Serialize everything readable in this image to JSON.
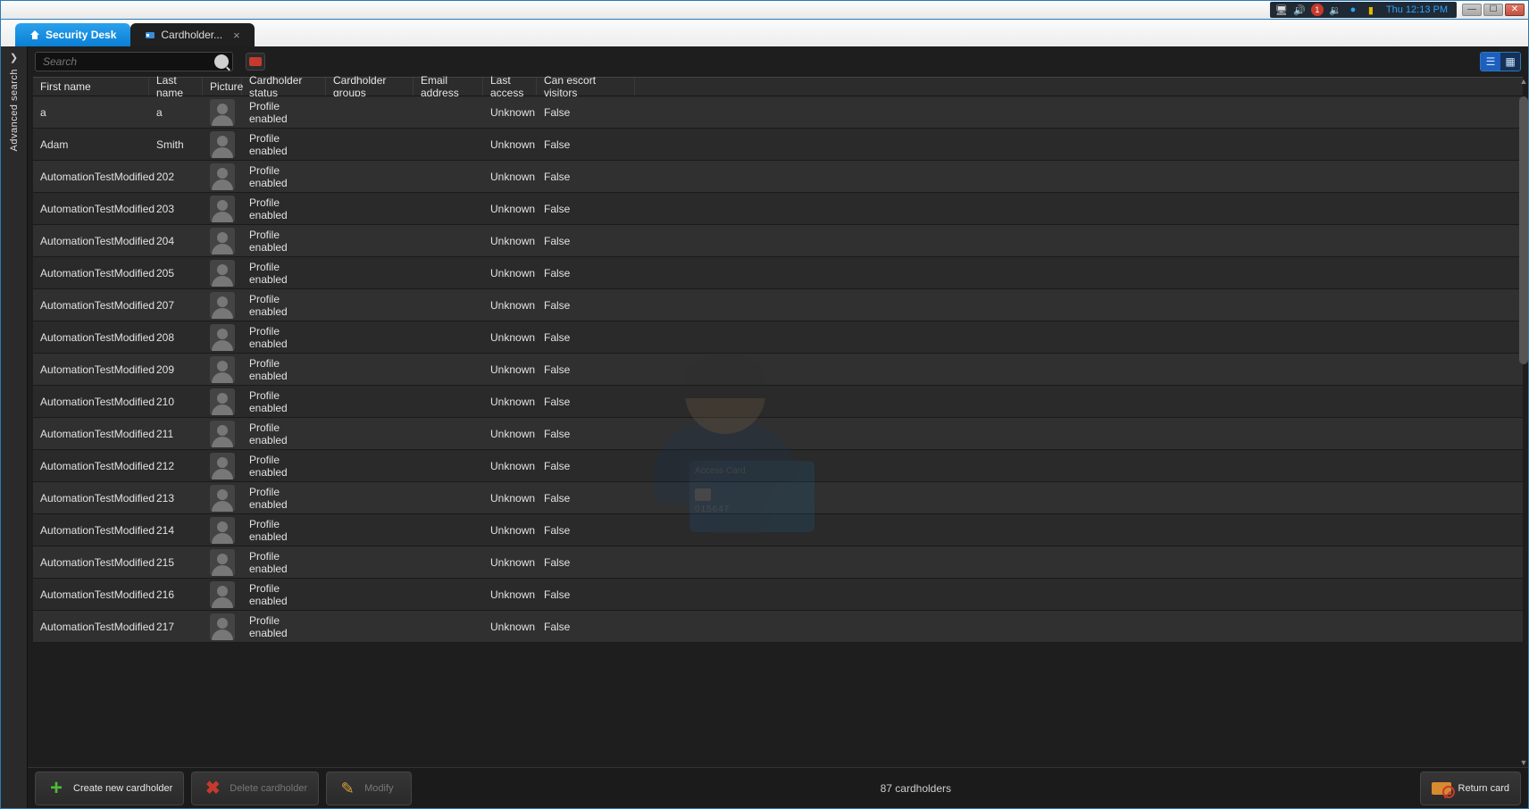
{
  "titlebar": {
    "clock": "Thu 12:13 PM",
    "tray_alert_badge": "1"
  },
  "tabs": {
    "home_label": "Security Desk",
    "active_label": "Cardholder..."
  },
  "sidebar": {
    "label": "Advanced search"
  },
  "toolbar": {
    "search_placeholder": "Search"
  },
  "columns": {
    "first_name": "First name",
    "last_name": "Last name",
    "picture": "Picture",
    "status": "Cardholder status",
    "groups": "Cardholder groups",
    "email": "Email address",
    "last_access": "Last access",
    "escort": "Can escort visitors"
  },
  "rows": [
    {
      "first": "a",
      "last": "a",
      "status": "Profile enabled",
      "groups": "",
      "email": "",
      "last_access": "Unknown",
      "escort": "False"
    },
    {
      "first": "Adam",
      "last": "Smith",
      "status": "Profile enabled",
      "groups": "",
      "email": "",
      "last_access": "Unknown",
      "escort": "False"
    },
    {
      "first": "AutomationTestModified",
      "last": "202",
      "status": "Profile enabled",
      "groups": "",
      "email": "",
      "last_access": "Unknown",
      "escort": "False"
    },
    {
      "first": "AutomationTestModified",
      "last": "203",
      "status": "Profile enabled",
      "groups": "",
      "email": "",
      "last_access": "Unknown",
      "escort": "False"
    },
    {
      "first": "AutomationTestModified",
      "last": "204",
      "status": "Profile enabled",
      "groups": "",
      "email": "",
      "last_access": "Unknown",
      "escort": "False"
    },
    {
      "first": "AutomationTestModified",
      "last": "205",
      "status": "Profile enabled",
      "groups": "",
      "email": "",
      "last_access": "Unknown",
      "escort": "False"
    },
    {
      "first": "AutomationTestModified",
      "last": "207",
      "status": "Profile enabled",
      "groups": "",
      "email": "",
      "last_access": "Unknown",
      "escort": "False"
    },
    {
      "first": "AutomationTestModified",
      "last": "208",
      "status": "Profile enabled",
      "groups": "",
      "email": "",
      "last_access": "Unknown",
      "escort": "False"
    },
    {
      "first": "AutomationTestModified",
      "last": "209",
      "status": "Profile enabled",
      "groups": "",
      "email": "",
      "last_access": "Unknown",
      "escort": "False"
    },
    {
      "first": "AutomationTestModified",
      "last": "210",
      "status": "Profile enabled",
      "groups": "",
      "email": "",
      "last_access": "Unknown",
      "escort": "False"
    },
    {
      "first": "AutomationTestModified",
      "last": "211",
      "status": "Profile enabled",
      "groups": "",
      "email": "",
      "last_access": "Unknown",
      "escort": "False"
    },
    {
      "first": "AutomationTestModified",
      "last": "212",
      "status": "Profile enabled",
      "groups": "",
      "email": "",
      "last_access": "Unknown",
      "escort": "False"
    },
    {
      "first": "AutomationTestModified",
      "last": "213",
      "status": "Profile enabled",
      "groups": "",
      "email": "",
      "last_access": "Unknown",
      "escort": "False"
    },
    {
      "first": "AutomationTestModified",
      "last": "214",
      "status": "Profile enabled",
      "groups": "",
      "email": "",
      "last_access": "Unknown",
      "escort": "False"
    },
    {
      "first": "AutomationTestModified",
      "last": "215",
      "status": "Profile enabled",
      "groups": "",
      "email": "",
      "last_access": "Unknown",
      "escort": "False"
    },
    {
      "first": "AutomationTestModified",
      "last": "216",
      "status": "Profile enabled",
      "groups": "",
      "email": "",
      "last_access": "Unknown",
      "escort": "False"
    },
    {
      "first": "AutomationTestModified",
      "last": "217",
      "status": "Profile enabled",
      "groups": "",
      "email": "",
      "last_access": "Unknown",
      "escort": "False"
    }
  ],
  "watermark": {
    "card_title": "Access Card",
    "card_num": "015647"
  },
  "footer": {
    "create_label": "Create new cardholder",
    "delete_label": "Delete cardholder",
    "modify_label": "Modify",
    "return_label": "Return card",
    "count_label": "87 cardholders"
  }
}
